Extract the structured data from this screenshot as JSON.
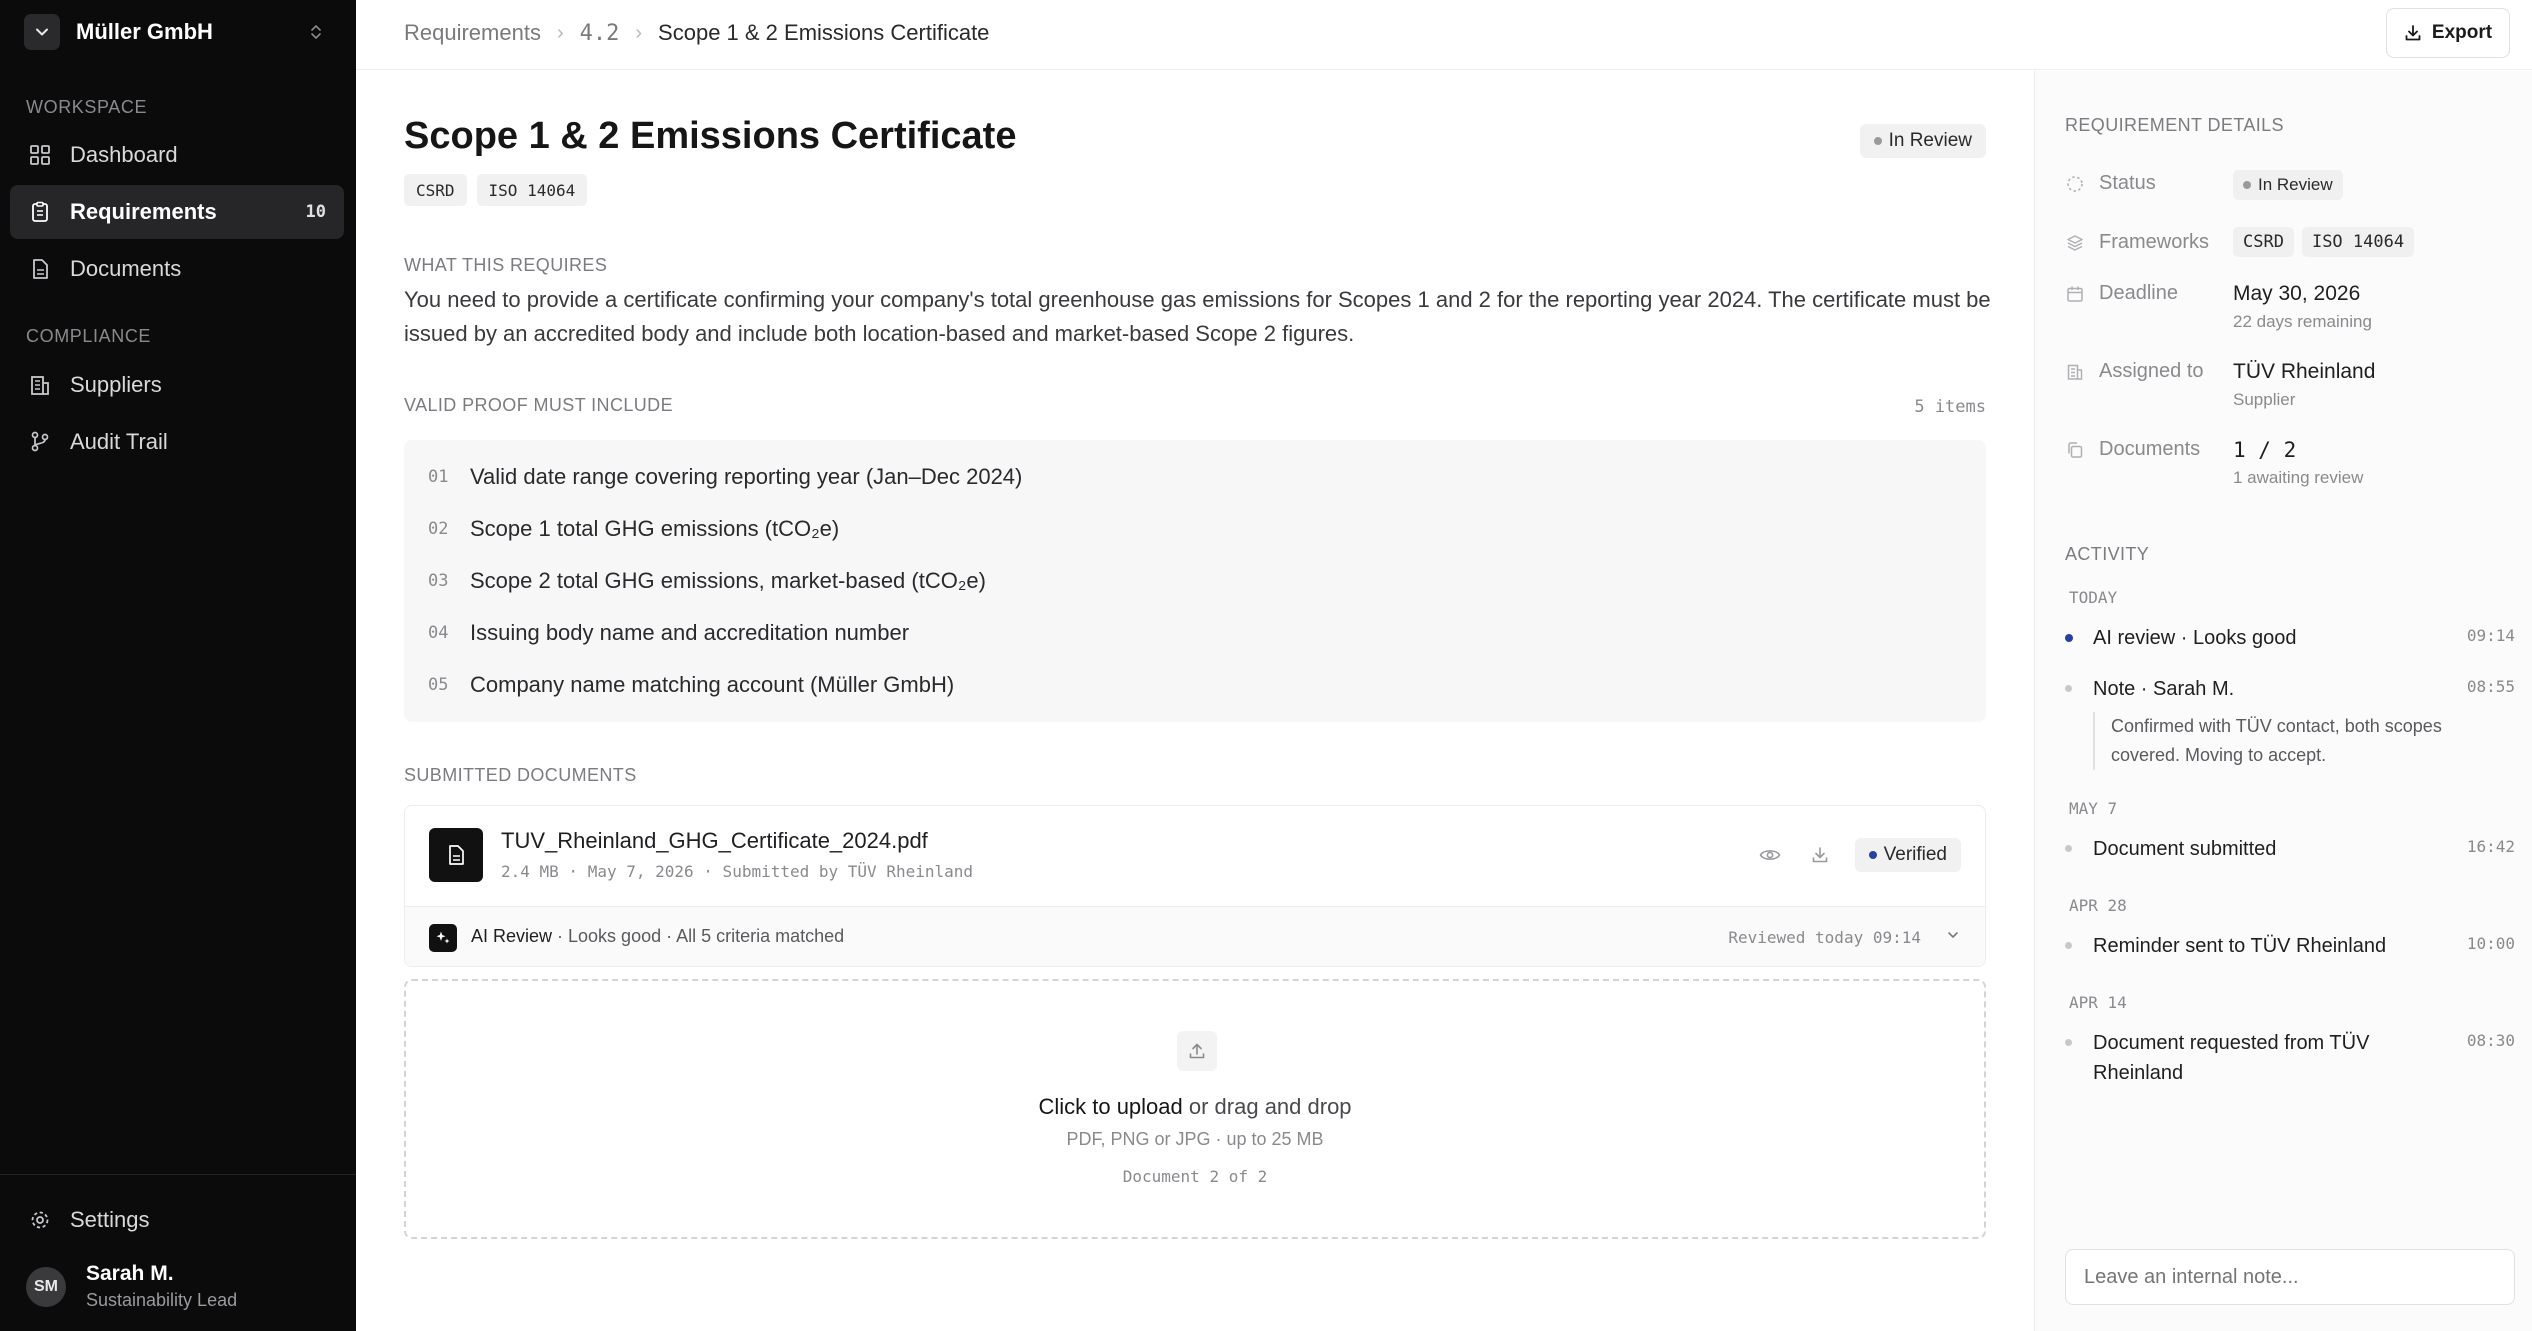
{
  "sidebar": {
    "org_name": "Müller GmbH",
    "sections": [
      {
        "label": "WORKSPACE"
      },
      {
        "label": "COMPLIANCE"
      }
    ],
    "items": [
      {
        "label": "Dashboard",
        "icon": "grid-icon"
      },
      {
        "label": "Requirements",
        "icon": "clipboard-icon",
        "count": "10",
        "active": true
      },
      {
        "label": "Documents",
        "icon": "file-icon"
      },
      {
        "label": "Suppliers",
        "icon": "building-icon"
      },
      {
        "label": "Audit Trail",
        "icon": "git-branch-icon"
      }
    ],
    "settings_label": "Settings",
    "user": {
      "initials": "SM",
      "name": "Sarah M.",
      "role": "Sustainability Lead"
    }
  },
  "topbar": {
    "breadcrumb": [
      "Requirements",
      "4.2",
      "Scope 1 & 2 Emissions Certificate"
    ],
    "export_label": "Export"
  },
  "requirement": {
    "title": "Scope 1 & 2 Emissions Certificate",
    "status": "In Review",
    "tags": [
      "CSRD",
      "ISO 14064"
    ],
    "what_label": "WHAT THIS REQUIRES",
    "description": "You need to provide a certificate confirming your company's total greenhouse gas emissions for Scopes 1 and 2 for the reporting year 2024. The certificate must be issued by an accredited body and include both location-based and market-based Scope 2 figures.",
    "proof_label": "VALID PROOF MUST INCLUDE",
    "proof_count": "5 items",
    "proof_items": [
      {
        "num": "01",
        "text": "Valid date range covering reporting year (Jan–Dec 2024)"
      },
      {
        "num": "02",
        "text": "Scope 1 total GHG emissions (tCO₂e)"
      },
      {
        "num": "03",
        "text": "Scope 2 total GHG emissions, market-based (tCO₂e)"
      },
      {
        "num": "04",
        "text": "Issuing body name and accreditation number"
      },
      {
        "num": "05",
        "text": "Company name matching account (Müller GmbH)"
      }
    ],
    "submitted_label": "SUBMITTED DOCUMENTS",
    "document": {
      "name": "TUV_Rheinland_GHG_Certificate_2024.pdf",
      "meta": "2.4 MB · May 7, 2026 · Submitted by TÜV Rheinland",
      "status": "Verified",
      "ai_title": "AI Review",
      "ai_summary": " · Looks good · All 5 criteria matched",
      "ai_reviewed": "Reviewed today 09:14"
    },
    "upload": {
      "cta": "Click to upload",
      "cta_rest": " or drag and drop",
      "hint": "PDF, PNG or JPG · up to 25 MB",
      "count": "Document 2 of 2"
    }
  },
  "details": {
    "label": "REQUIREMENT DETAILS",
    "status_key": "Status",
    "status_val": "In Review",
    "frameworks_key": "Frameworks",
    "frameworks": [
      "CSRD",
      "ISO 14064"
    ],
    "deadline_key": "Deadline",
    "deadline_val": "May 30, 2026",
    "deadline_sub": "22 days remaining",
    "assigned_key": "Assigned to",
    "assigned_val": "TÜV Rheinland",
    "assigned_sub": "Supplier",
    "documents_key": "Documents",
    "documents_val": "1 / 2",
    "documents_sub": "1 awaiting review"
  },
  "activity": {
    "label": "ACTIVITY",
    "groups": [
      {
        "day": "TODAY",
        "events": [
          {
            "text": "AI review · Looks good",
            "time": "09:14"
          },
          {
            "text": "Note · Sarah M.",
            "time": "08:55",
            "note": "Confirmed with TÜV contact, both scopes covered. Moving to accept."
          }
        ]
      },
      {
        "day": "MAY 7",
        "events": [
          {
            "text": "Document submitted",
            "time": "16:42"
          }
        ]
      },
      {
        "day": "APR 28",
        "events": [
          {
            "text": "Reminder sent to TÜV Rheinland",
            "time": "10:00"
          }
        ]
      },
      {
        "day": "APR 14",
        "events": [
          {
            "text": "Document requested from TÜV Rheinland",
            "time": "08:30"
          }
        ]
      }
    ],
    "note_placeholder": "Leave an internal note..."
  },
  "colors": {
    "sidebar_bg": "#0b0b0c",
    "accent_dot": "#2840a0",
    "verified_dot": "#2840a0",
    "status_dot": "#9a9a9e"
  }
}
